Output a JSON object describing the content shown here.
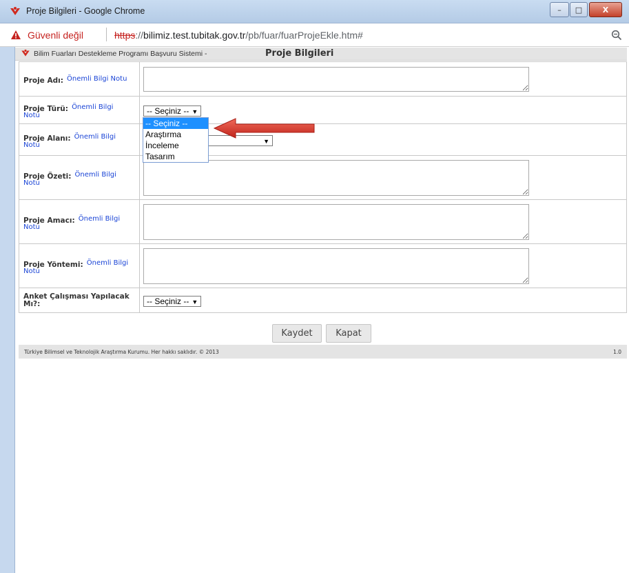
{
  "window": {
    "title": "Proje Bilgileri - Google Chrome",
    "controls": {
      "minimize": "–",
      "maximize": "□",
      "close": "X"
    }
  },
  "addressbar": {
    "security_label": "Güvenli değil",
    "url_scheme": "https",
    "url_separator": "://",
    "url_host": "bilimiz.test.tubitak.gov.tr",
    "url_path": "/pb/fuar/fuarProjeEkle.htm#"
  },
  "header": {
    "system_name": "Bilim Fuarları Destekleme Programı Başvuru Sistemi -",
    "page_title": "Proje Bilgileri"
  },
  "form": {
    "note_text_1": "Önemli Bilgi Notu",
    "note_text_a": "Önemli Bilgi",
    "note_text_b": "Notu",
    "fields": {
      "proje_adi": "Proje Adı:",
      "proje_turu": "Proje Türü:",
      "proje_alani": "Proje Alanı:",
      "proje_ozeti": "Proje Özeti:",
      "proje_amaci": "Proje Amacı:",
      "proje_yontemi": "Proje Yöntemi:",
      "anket": "Anket Çalışması Yapılacak Mı?:"
    },
    "select_placeholder": "-- Seçiniz --",
    "proje_turu_options": [
      "-- Seçiniz --",
      "Araştırma",
      "İnceleme",
      "Tasarım"
    ],
    "proje_turu_selected_index": 0
  },
  "buttons": {
    "save": "Kaydet",
    "close": "Kapat"
  },
  "footer": {
    "copyright": "Türkiye Bilimsel ve Teknolojik Araştırma Kurumu. Her hakkı saklıdır. © 2013",
    "version": "1.0"
  },
  "colors": {
    "accent_red": "#c5221f",
    "link_blue": "#1a44d6",
    "selected_option": "#1e90ff",
    "annotation_arrow": "#d9322a"
  },
  "icons": {
    "app": "tubitak-logo-icon",
    "security": "warning-triangle-icon",
    "zoom": "zoom-icon"
  }
}
